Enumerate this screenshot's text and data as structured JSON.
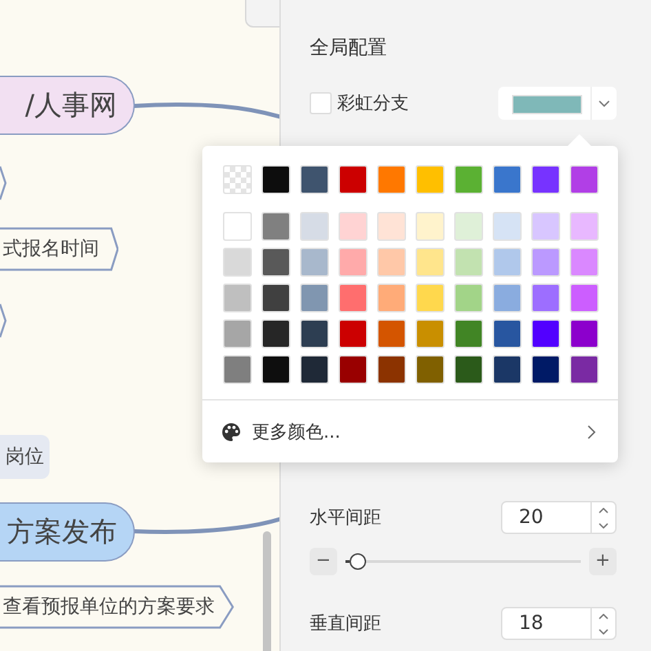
{
  "canvas": {
    "nodes": [
      {
        "kind": "pill",
        "text": "/人事网",
        "color": "#f2e0f2"
      },
      {
        "kind": "tip"
      },
      {
        "kind": "tag",
        "text": "式报名时间"
      },
      {
        "kind": "tip"
      },
      {
        "kind": "label",
        "text": "岗位",
        "color": "#e5e9f2"
      },
      {
        "kind": "pill",
        "text": "方案发布",
        "color": "#b5d5f5"
      },
      {
        "kind": "tag",
        "text": "查看预报单位的方案要求"
      }
    ]
  },
  "settings": {
    "section_title": "全局配置",
    "rainbow_branch": {
      "label": "彩虹分支",
      "checked": false
    },
    "branch_color": {
      "color": "#7fb8b8"
    },
    "horizontal_spacing": {
      "label": "水平间距",
      "value": "20",
      "level": 0.05,
      "minus": "−",
      "plus": "+"
    },
    "vertical_spacing": {
      "label": "垂直间距",
      "value": "18"
    }
  },
  "color_picker": {
    "rows": [
      [
        {
          "kind": "transparent"
        },
        {
          "kind": "solid",
          "color": "#0d0d0d"
        },
        {
          "kind": "solid",
          "color": "#3f546e"
        },
        {
          "kind": "solid",
          "color": "#cc0000"
        },
        {
          "kind": "solid",
          "color": "#ff7800"
        },
        {
          "kind": "solid",
          "color": "#ffbf00"
        },
        {
          "kind": "solid",
          "color": "#5bb133"
        },
        {
          "kind": "solid",
          "color": "#3a76cc"
        },
        {
          "kind": "solid",
          "color": "#7733ff"
        },
        {
          "kind": "solid",
          "color": "#b13fe6"
        }
      ],
      [
        {
          "kind": "solid",
          "color": "#ffffff"
        },
        {
          "kind": "solid",
          "color": "#808080"
        },
        {
          "kind": "solid",
          "color": "#d6dce6"
        },
        {
          "kind": "solid",
          "color": "#ffd3d3"
        },
        {
          "kind": "solid",
          "color": "#ffe3d6"
        },
        {
          "kind": "solid",
          "color": "#fff3cc"
        },
        {
          "kind": "solid",
          "color": "#dff0d8"
        },
        {
          "kind": "solid",
          "color": "#d6e3f5"
        },
        {
          "kind": "solid",
          "color": "#d8c6ff"
        },
        {
          "kind": "solid",
          "color": "#e8b8ff"
        }
      ],
      [
        {
          "kind": "solid",
          "color": "#d9d9d9"
        },
        {
          "kind": "solid",
          "color": "#595959"
        },
        {
          "kind": "solid",
          "color": "#a8b8cc"
        },
        {
          "kind": "solid",
          "color": "#ffaaaa"
        },
        {
          "kind": "solid",
          "color": "#ffc8a8"
        },
        {
          "kind": "solid",
          "color": "#ffe58c"
        },
        {
          "kind": "solid",
          "color": "#c2e2b0"
        },
        {
          "kind": "solid",
          "color": "#b0c8eb"
        },
        {
          "kind": "solid",
          "color": "#bb99ff"
        },
        {
          "kind": "solid",
          "color": "#da88ff"
        }
      ],
      [
        {
          "kind": "solid",
          "color": "#bfbfbf"
        },
        {
          "kind": "solid",
          "color": "#404040"
        },
        {
          "kind": "solid",
          "color": "#8096b0"
        },
        {
          "kind": "solid",
          "color": "#ff6e6e"
        },
        {
          "kind": "solid",
          "color": "#ffab78"
        },
        {
          "kind": "solid",
          "color": "#ffd84d"
        },
        {
          "kind": "solid",
          "color": "#a2d488"
        },
        {
          "kind": "solid",
          "color": "#8aacdf"
        },
        {
          "kind": "solid",
          "color": "#9d6eff"
        },
        {
          "kind": "solid",
          "color": "#cc5eff"
        }
      ],
      [
        {
          "kind": "solid",
          "color": "#a6a6a6"
        },
        {
          "kind": "solid",
          "color": "#262626"
        },
        {
          "kind": "solid",
          "color": "#2d3e52"
        },
        {
          "kind": "solid",
          "color": "#cc0001"
        },
        {
          "kind": "solid",
          "color": "#d45500"
        },
        {
          "kind": "solid",
          "color": "#c98f00"
        },
        {
          "kind": "solid",
          "color": "#418525"
        },
        {
          "kind": "solid",
          "color": "#2856a0"
        },
        {
          "kind": "solid",
          "color": "#5200ff"
        },
        {
          "kind": "solid",
          "color": "#8c00cc"
        }
      ],
      [
        {
          "kind": "solid",
          "color": "#7f7f7f"
        },
        {
          "kind": "solid",
          "color": "#0e0e0e"
        },
        {
          "kind": "solid",
          "color": "#1f2937"
        },
        {
          "kind": "solid",
          "color": "#990000"
        },
        {
          "kind": "solid",
          "color": "#8c3300"
        },
        {
          "kind": "solid",
          "color": "#806000"
        },
        {
          "kind": "solid",
          "color": "#2b5a1a"
        },
        {
          "kind": "solid",
          "color": "#1b3766"
        },
        {
          "kind": "solid",
          "color": "#001a66"
        },
        {
          "kind": "solid",
          "color": "#7a2aa3"
        }
      ]
    ],
    "more_colors": "更多颜色..."
  }
}
